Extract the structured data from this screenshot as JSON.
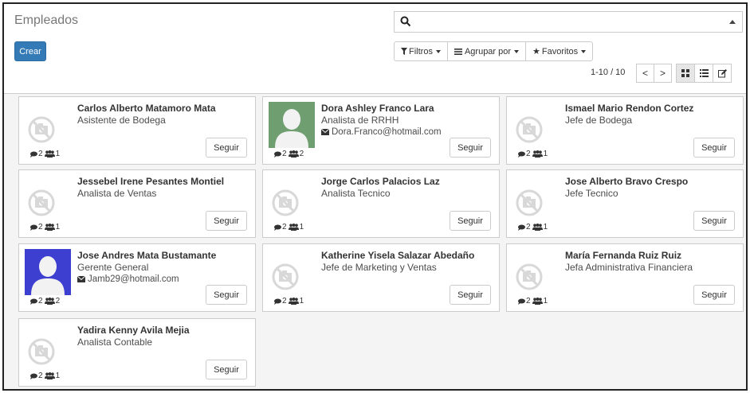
{
  "header": {
    "title": "Empleados",
    "create_label": "Crear",
    "search_value": ""
  },
  "filters": {
    "filter_label": "Filtros",
    "group_label": "Agrupar por",
    "fav_label": "Favoritos"
  },
  "pager": {
    "text": "1-10 / 10",
    "prev": "<",
    "next": ">"
  },
  "colors": {
    "primary": "#337ab7",
    "avatar_green": "#6f9f70",
    "avatar_blue": "#3c3fcf"
  },
  "follow_label": "Seguir",
  "employees": [
    {
      "name": "Carlos Alberto Matamoro Mata",
      "job": "Asistente de Bodega",
      "email": "",
      "messages": "2",
      "followers": "1",
      "avatar": "placeholder"
    },
    {
      "name": "Dora Ashley Franco Lara",
      "job": "Analista de RRHH",
      "email": "Dora.Franco@hotmail.com",
      "messages": "2",
      "followers": "2",
      "avatar": "green"
    },
    {
      "name": "Ismael Mario Rendon Cortez",
      "job": "Jefe de Bodega",
      "email": "",
      "messages": "2",
      "followers": "1",
      "avatar": "placeholder"
    },
    {
      "name": "Jessebel Irene Pesantes Montiel",
      "job": "Analista de Ventas",
      "email": "",
      "messages": "2",
      "followers": "1",
      "avatar": "placeholder"
    },
    {
      "name": "Jorge Carlos Palacios Laz",
      "job": "Analista Tecnico",
      "email": "",
      "messages": "2",
      "followers": "1",
      "avatar": "placeholder"
    },
    {
      "name": "Jose Alberto Bravo Crespo",
      "job": "Jefe Tecnico",
      "email": "",
      "messages": "2",
      "followers": "1",
      "avatar": "placeholder"
    },
    {
      "name": "Jose Andres Mata Bustamante",
      "job": "Gerente General",
      "email": "Jamb29@hotmail.com",
      "messages": "2",
      "followers": "2",
      "avatar": "blue"
    },
    {
      "name": "Katherine Yisela Salazar Abedaño",
      "job": "Jefe de Marketing y Ventas",
      "email": "",
      "messages": "2",
      "followers": "1",
      "avatar": "placeholder"
    },
    {
      "name": "María Fernanda Ruiz Ruiz",
      "job": "Jefa Administrativa Financiera",
      "email": "",
      "messages": "2",
      "followers": "1",
      "avatar": "placeholder"
    },
    {
      "name": "Yadira Kenny Avila Mejia",
      "job": "Analista Contable",
      "email": "",
      "messages": "2",
      "followers": "1",
      "avatar": "placeholder"
    }
  ]
}
